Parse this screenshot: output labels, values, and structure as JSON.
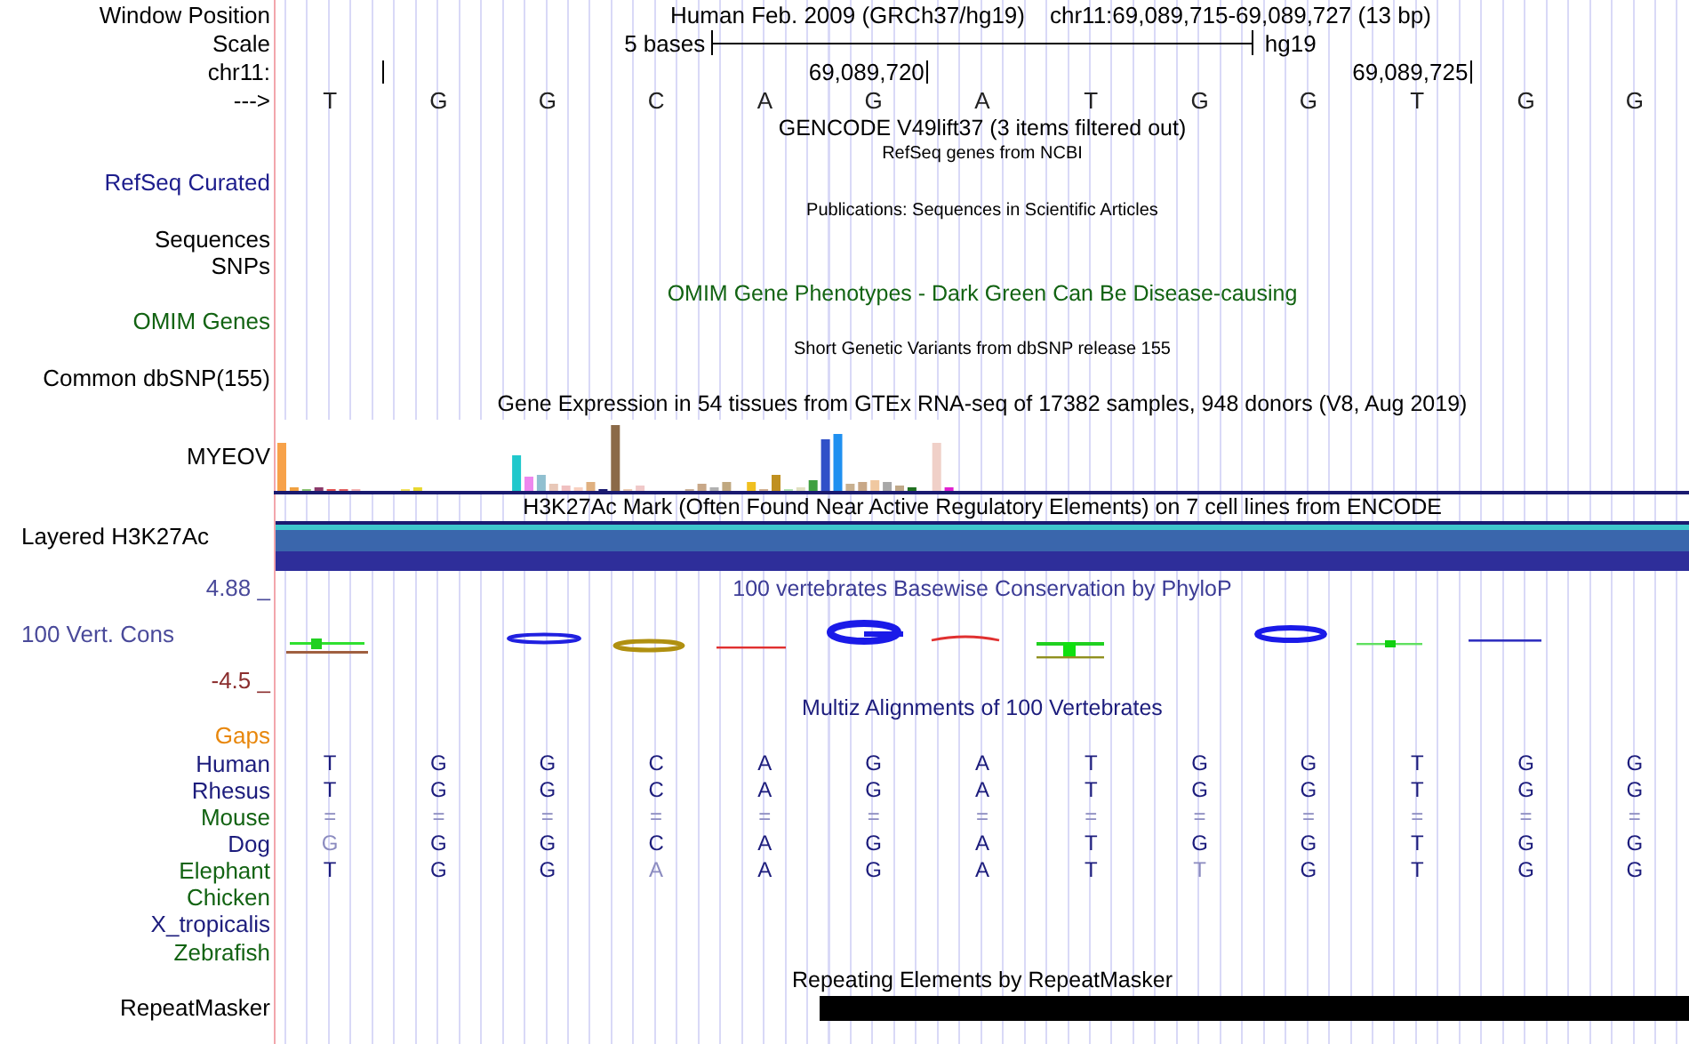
{
  "header": {
    "label": "Window Position",
    "assembly": "Human Feb. 2009 (GRCh37/hg19)",
    "range": "chr11:69,089,715-69,089,727 (13 bp)"
  },
  "scale": {
    "label": "Scale",
    "span": "5 bases",
    "assembly": "hg19"
  },
  "coordinates": {
    "label": "chr11:",
    "ticks": [
      "69,089,720",
      "69,089,725"
    ]
  },
  "reference": {
    "label": "--->",
    "bases": [
      "T",
      "G",
      "G",
      "C",
      "A",
      "G",
      "A",
      "T",
      "G",
      "G",
      "T",
      "G",
      "G"
    ]
  },
  "tracks": [
    {
      "kind": "title",
      "title": {
        "text": "GENCODE V49lift37 (3 items filtered out)",
        "color": "#000000"
      }
    },
    {
      "kind": "subtitle",
      "title": {
        "text": "RefSeq genes from NCBI",
        "color": "#000000"
      }
    },
    {
      "kind": "label",
      "label": {
        "text": "RefSeq Curated",
        "color": "#1c1c8c"
      }
    },
    {
      "kind": "subtitle",
      "title": {
        "text": "Publications: Sequences in Scientific Articles",
        "color": "#000000"
      }
    },
    {
      "kind": "label",
      "label": {
        "text": "Sequences",
        "color": "#000000"
      }
    },
    {
      "kind": "label",
      "label": {
        "text": "SNPs",
        "color": "#000000"
      }
    },
    {
      "kind": "title",
      "title": {
        "text": "OMIM Gene Phenotypes - Dark Green Can Be Disease-causing",
        "color": "#126312"
      }
    },
    {
      "kind": "label",
      "label": {
        "text": "OMIM Genes",
        "color": "#126312"
      }
    },
    {
      "kind": "subtitle",
      "title": {
        "text": "Short Genetic Variants from dbSNP release 155",
        "color": "#000000"
      }
    },
    {
      "kind": "label",
      "label": {
        "text": "Common dbSNP(155)",
        "color": "#000000"
      }
    },
    {
      "kind": "title",
      "title": {
        "text": "Gene Expression in 54 tissues from GTEx RNA-seq of 17382 samples, 948 donors (V8, Aug 2019)",
        "color": "#000000"
      }
    },
    {
      "kind": "expression",
      "label": {
        "text": "MYEOV",
        "color": "#000000"
      }
    },
    {
      "kind": "title",
      "title": {
        "text": "H3K27Ac Mark (Often Found Near Active Regulatory Elements) on 7 cell lines from ENCODE",
        "color": "#000000"
      }
    },
    {
      "kind": "bands",
      "label": {
        "text": "Layered H3K27Ac",
        "color": "#000000"
      }
    },
    {
      "kind": "title",
      "label": {
        "text": "4.88 _",
        "color": "#4a4a9a"
      },
      "title": {
        "text": "100 vertebrates Basewise Conservation by PhyloP",
        "color": "#3c3c96"
      }
    },
    {
      "kind": "logo",
      "label": {
        "text": "100 Vert. Cons",
        "color": "#4a4a9a"
      }
    },
    {
      "kind": "label",
      "label": {
        "text": "-4.5 _",
        "color": "#8b2e2e"
      }
    },
    {
      "kind": "title",
      "title": {
        "text": "Multiz Alignments of 100 Vertebrates",
        "color": "#1c1c7c"
      }
    },
    {
      "kind": "label",
      "label": {
        "text": "Gaps",
        "color": "#e8870c"
      }
    },
    {
      "kind": "alignment",
      "label": {
        "text": "Human",
        "color": "#1c1c7c"
      },
      "bases": [
        {
          "base": "T",
          "faded": false
        },
        {
          "base": "G",
          "faded": false
        },
        {
          "base": "G",
          "faded": false
        },
        {
          "base": "C",
          "faded": false
        },
        {
          "base": "A",
          "faded": false
        },
        {
          "base": "G",
          "faded": false
        },
        {
          "base": "A",
          "faded": false
        },
        {
          "base": "T",
          "faded": false
        },
        {
          "base": "G",
          "faded": false
        },
        {
          "base": "G",
          "faded": false
        },
        {
          "base": "T",
          "faded": false
        },
        {
          "base": "G",
          "faded": false
        },
        {
          "base": "G",
          "faded": false
        }
      ]
    },
    {
      "kind": "alignment",
      "label": {
        "text": "Rhesus",
        "color": "#1c1c7c"
      },
      "bases": [
        {
          "base": "T",
          "faded": false
        },
        {
          "base": "G",
          "faded": false
        },
        {
          "base": "G",
          "faded": false
        },
        {
          "base": "C",
          "faded": false
        },
        {
          "base": "A",
          "faded": false
        },
        {
          "base": "G",
          "faded": false
        },
        {
          "base": "A",
          "faded": false
        },
        {
          "base": "T",
          "faded": false
        },
        {
          "base": "G",
          "faded": false
        },
        {
          "base": "G",
          "faded": false
        },
        {
          "base": "T",
          "faded": false
        },
        {
          "base": "G",
          "faded": false
        },
        {
          "base": "G",
          "faded": false
        }
      ]
    },
    {
      "kind": "alignment",
      "label": {
        "text": "Mouse",
        "color": "#126312"
      },
      "bases": [
        {
          "base": "=",
          "faded": true
        },
        {
          "base": "=",
          "faded": true
        },
        {
          "base": "=",
          "faded": true
        },
        {
          "base": "=",
          "faded": true
        },
        {
          "base": "=",
          "faded": true
        },
        {
          "base": "=",
          "faded": true
        },
        {
          "base": "=",
          "faded": true
        },
        {
          "base": "=",
          "faded": true
        },
        {
          "base": "=",
          "faded": true
        },
        {
          "base": "=",
          "faded": true
        },
        {
          "base": "=",
          "faded": true
        },
        {
          "base": "=",
          "faded": true
        },
        {
          "base": "=",
          "faded": true
        }
      ]
    },
    {
      "kind": "alignment",
      "label": {
        "text": "Dog",
        "color": "#1c1c7c"
      },
      "bases": [
        {
          "base": "G",
          "faded": true
        },
        {
          "base": "G",
          "faded": false
        },
        {
          "base": "G",
          "faded": false
        },
        {
          "base": "C",
          "faded": false
        },
        {
          "base": "A",
          "faded": false
        },
        {
          "base": "G",
          "faded": false
        },
        {
          "base": "A",
          "faded": false
        },
        {
          "base": "T",
          "faded": false
        },
        {
          "base": "G",
          "faded": false
        },
        {
          "base": "G",
          "faded": false
        },
        {
          "base": "T",
          "faded": false
        },
        {
          "base": "G",
          "faded": false
        },
        {
          "base": "G",
          "faded": false
        }
      ]
    },
    {
      "kind": "alignment",
      "label": {
        "text": "Elephant",
        "color": "#126312"
      },
      "bases": [
        {
          "base": "T",
          "faded": false
        },
        {
          "base": "G",
          "faded": false
        },
        {
          "base": "G",
          "faded": false
        },
        {
          "base": "A",
          "faded": true
        },
        {
          "base": "A",
          "faded": false
        },
        {
          "base": "G",
          "faded": false
        },
        {
          "base": "A",
          "faded": false
        },
        {
          "base": "T",
          "faded": false
        },
        {
          "base": "T",
          "faded": true
        },
        {
          "base": "G",
          "faded": false
        },
        {
          "base": "T",
          "faded": false
        },
        {
          "base": "G",
          "faded": false
        },
        {
          "base": "G",
          "faded": false
        }
      ]
    },
    {
      "kind": "label",
      "label": {
        "text": "Chicken",
        "color": "#126312"
      }
    },
    {
      "kind": "label",
      "label": {
        "text": "X_tropicalis",
        "color": "#1c1c7c"
      }
    },
    {
      "kind": "label",
      "label": {
        "text": "Zebrafish",
        "color": "#126312"
      }
    },
    {
      "kind": "title",
      "title": {
        "text": "Repeating Elements by RepeatMasker",
        "color": "#000000"
      }
    },
    {
      "kind": "repeat",
      "label": {
        "text": "RepeatMasker",
        "color": "#000000"
      }
    }
  ]
}
